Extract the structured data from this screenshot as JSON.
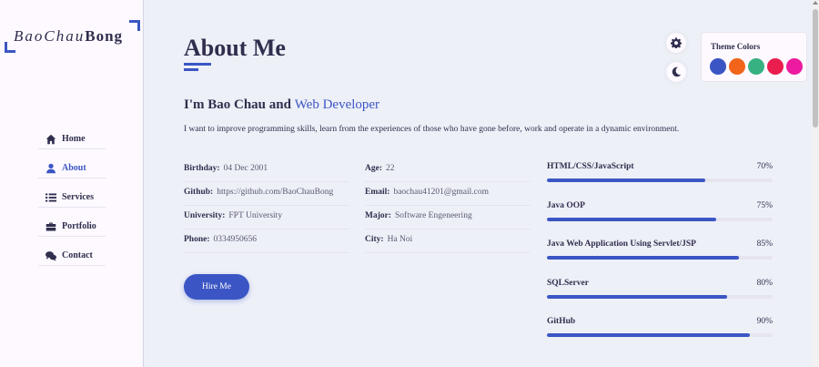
{
  "logo": {
    "text_script": "BaoChau",
    "text_bold": "Bong"
  },
  "nav": [
    {
      "label": "Home",
      "icon": "home-icon",
      "active": false
    },
    {
      "label": "About",
      "icon": "user-icon",
      "active": true
    },
    {
      "label": "Services",
      "icon": "list-icon",
      "active": false
    },
    {
      "label": "Portfolio",
      "icon": "briefcase-icon",
      "active": false
    },
    {
      "label": "Contact",
      "icon": "comments-icon",
      "active": false
    }
  ],
  "page": {
    "title": "About Me",
    "headline_prefix": "I'm Bao Chau and ",
    "headline_accent": "Web Developer",
    "intro": "I want to improve programming skills, learn from the experiences of those who have gone before, work and operate in a dynamic environment."
  },
  "info_col1": [
    {
      "key": "Birthday:",
      "value": "04 Dec 2001"
    },
    {
      "key": "Github:",
      "value": "https://github.com/BaoChauBong"
    },
    {
      "key": "University:",
      "value": "FPT University"
    },
    {
      "key": "Phone:",
      "value": "0334950656"
    }
  ],
  "info_col2": [
    {
      "key": "Age:",
      "value": "22"
    },
    {
      "key": "Email:",
      "value": "baochau41201@gmail.com"
    },
    {
      "key": "Major:",
      "value": "Software Engeneering"
    },
    {
      "key": "City:",
      "value": "Ha Noi"
    }
  ],
  "hire_button": "Hire Me",
  "skills": [
    {
      "name": "HTML/CSS/JavaScript",
      "percent_label": "70%",
      "level": 0.7
    },
    {
      "name": "Java OOP",
      "percent_label": "75%",
      "level": 0.75
    },
    {
      "name": "Java Web Application Using Servlet/JSP",
      "percent_label": "85%",
      "level": 0.85
    },
    {
      "name": "SQLServer",
      "percent_label": "80%",
      "level": 0.8
    },
    {
      "name": "GitHub",
      "percent_label": "90%",
      "level": 0.9
    }
  ],
  "theme": {
    "title": "Theme Colors",
    "colors": [
      "#3b56c4",
      "#f2641a",
      "#37b182",
      "#e91e4e",
      "#ec1b9f"
    ],
    "accent": "#3b56c4"
  }
}
